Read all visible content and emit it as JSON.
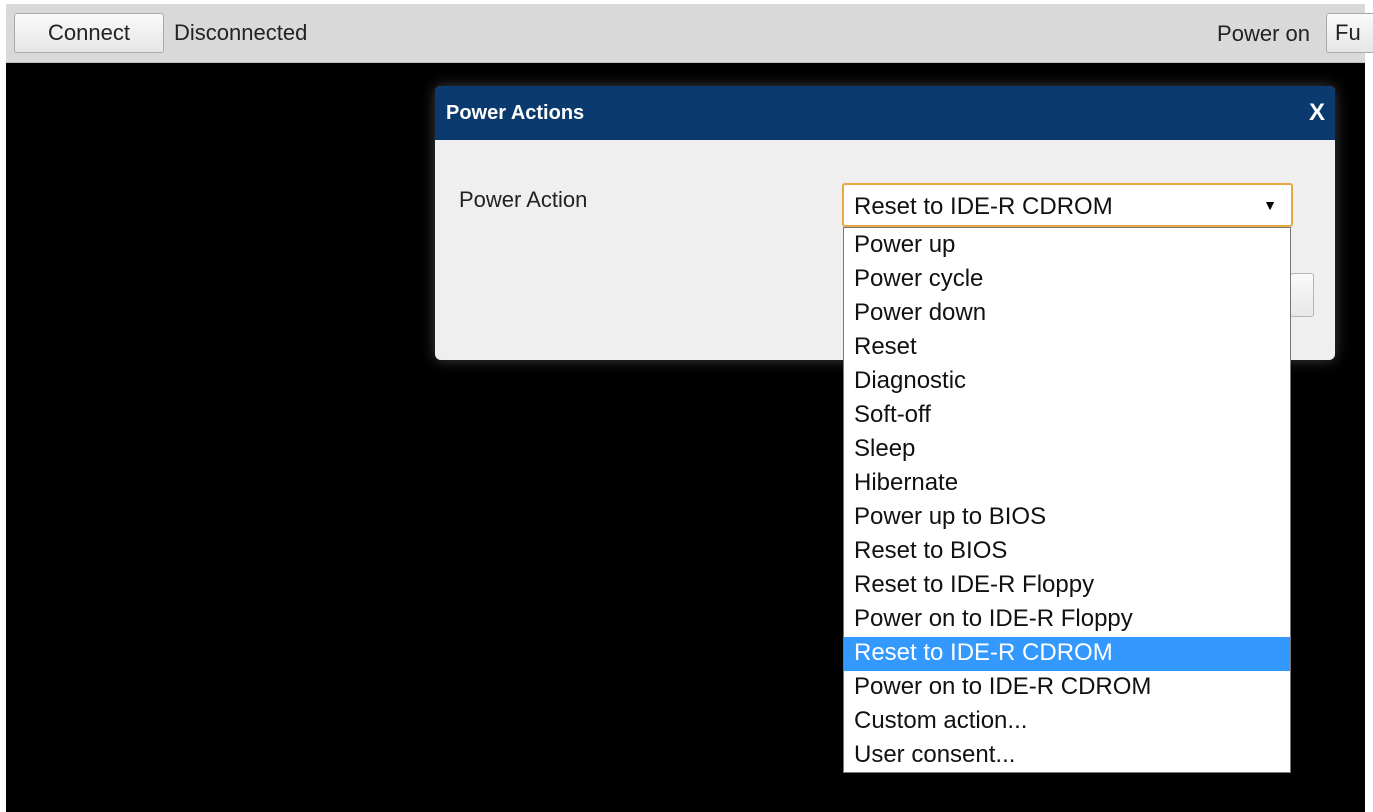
{
  "toolbar": {
    "connect_label": "Connect",
    "status": "Disconnected",
    "power_on_label": "Power on",
    "power_on_select_value": "Fu"
  },
  "dialog": {
    "title": "Power Actions",
    "close_label": "X",
    "field_label": "Power Action",
    "selected_value": "Reset to IDE-R CDROM",
    "arrow": "▼",
    "options": [
      "Power up",
      "Power cycle",
      "Power down",
      "Reset",
      "Diagnostic",
      "Soft-off",
      "Sleep",
      "Hibernate",
      "Power up to BIOS",
      "Reset to BIOS",
      "Reset to IDE-R Floppy",
      "Power on to IDE-R Floppy",
      "Reset to IDE-R CDROM",
      "Power on to IDE-R CDROM",
      "Custom action...",
      "User consent..."
    ],
    "selected_index": 12
  },
  "colors": {
    "header": "#0b3a6e",
    "highlight": "#3399ff",
    "focus_border": "#e5a93f",
    "console": "#000000"
  }
}
